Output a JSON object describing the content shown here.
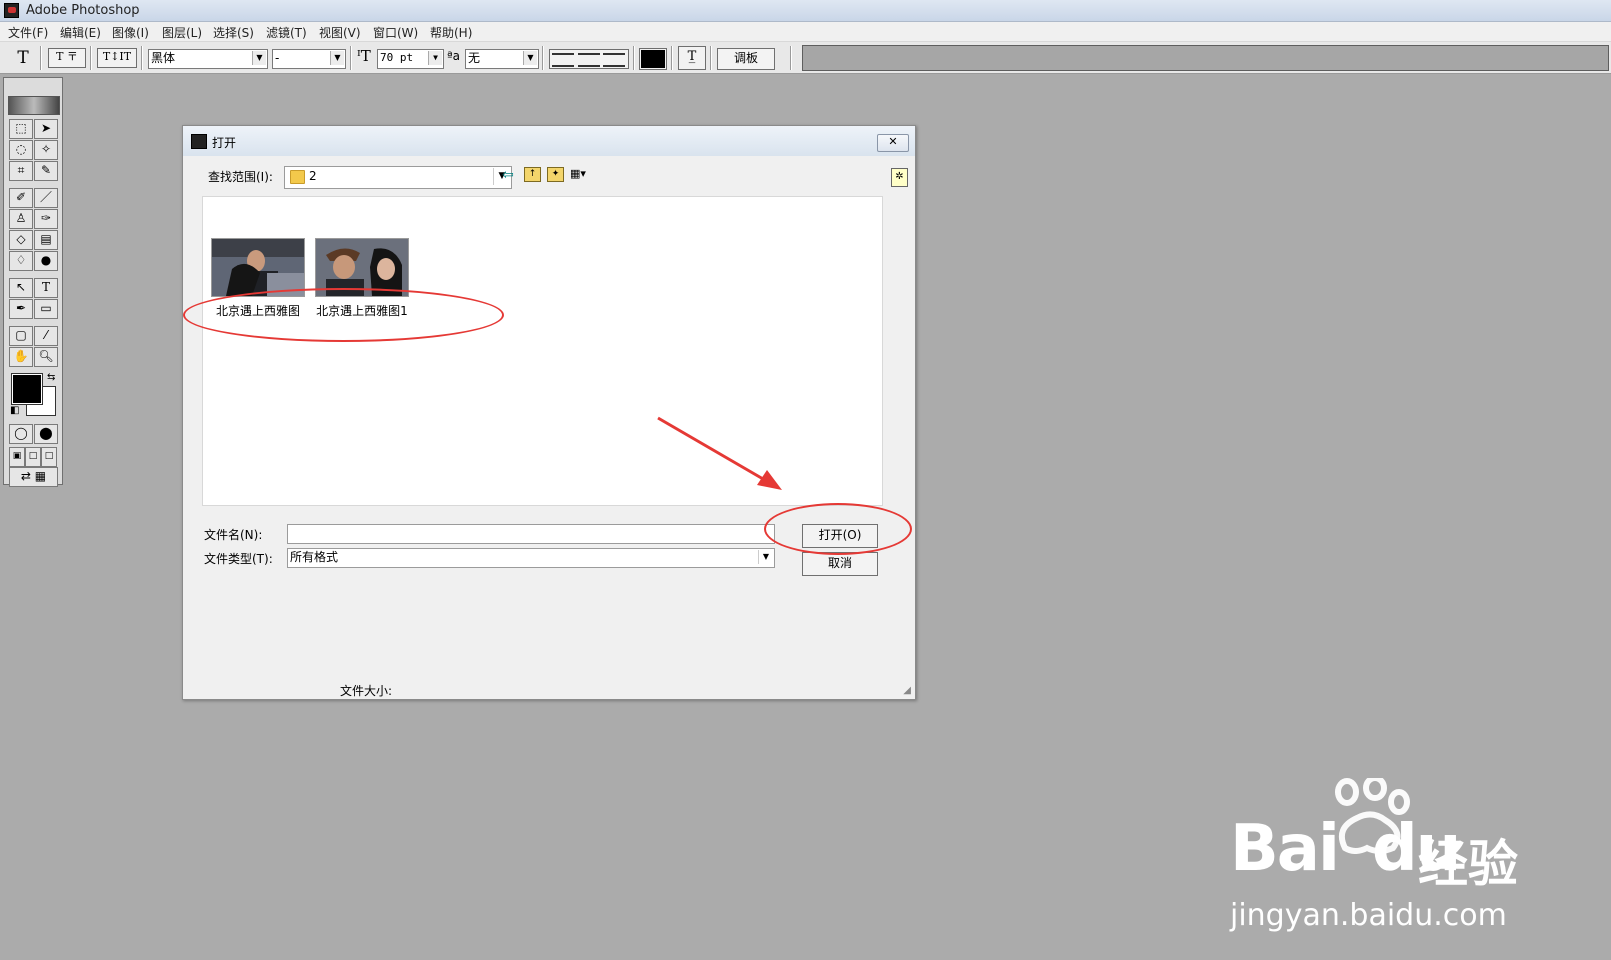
{
  "app": {
    "title": "Adobe Photoshop"
  },
  "menu": [
    {
      "label": "文件(F)"
    },
    {
      "label": "编辑(E)"
    },
    {
      "label": "图像(I)"
    },
    {
      "label": "图层(L)"
    },
    {
      "label": "选择(S)"
    },
    {
      "label": "滤镜(T)"
    },
    {
      "label": "视图(V)"
    },
    {
      "label": "窗口(W)"
    },
    {
      "label": "帮助(H)"
    }
  ],
  "options_bar": {
    "font_family": "黑体",
    "font_style": "-",
    "font_size": "70 pt",
    "antialias": "无",
    "palette_label": "调板",
    "color_swatch": "#000000"
  },
  "dialog": {
    "title": "打开",
    "look_in_label": "查找范围(I):",
    "look_in_value": "2",
    "files": [
      {
        "name": "北京遇上西雅图"
      },
      {
        "name": "北京遇上西雅图1"
      }
    ],
    "filename_label": "文件名(N):",
    "filename_value": "",
    "filetype_label": "文件类型(T):",
    "filetype_value": "所有格式",
    "open_button": "打开(O)",
    "cancel_button": "取消",
    "filesize_label": "文件大小:"
  },
  "watermark": {
    "brand": "Bai",
    "brand_tail": "du",
    "tagline": "经验",
    "url": "jingyan.baidu.com"
  },
  "colors": {
    "workspace_bg": "#ababab",
    "annotation_red": "#e53935"
  }
}
